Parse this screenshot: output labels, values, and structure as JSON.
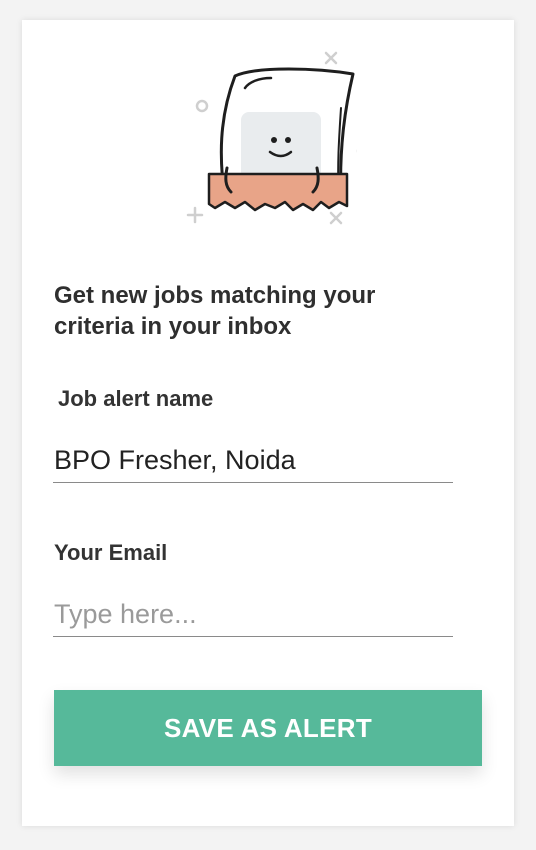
{
  "alert_card": {
    "illustration_icon": "paper-envelope-mascot-icon",
    "heading": "Get new jobs matching your criteria in your inbox",
    "job_alert_name": {
      "label": "Job alert name",
      "value": "BPO Fresher, Noida"
    },
    "email": {
      "label": "Your Email",
      "placeholder": "Type here...",
      "value": ""
    },
    "save_button_label": "SAVE AS ALERT"
  },
  "colors": {
    "accent": "#56b99a",
    "envelope": "#e8a488",
    "text": "#2f2f2f",
    "underline": "#8a8a8a"
  }
}
